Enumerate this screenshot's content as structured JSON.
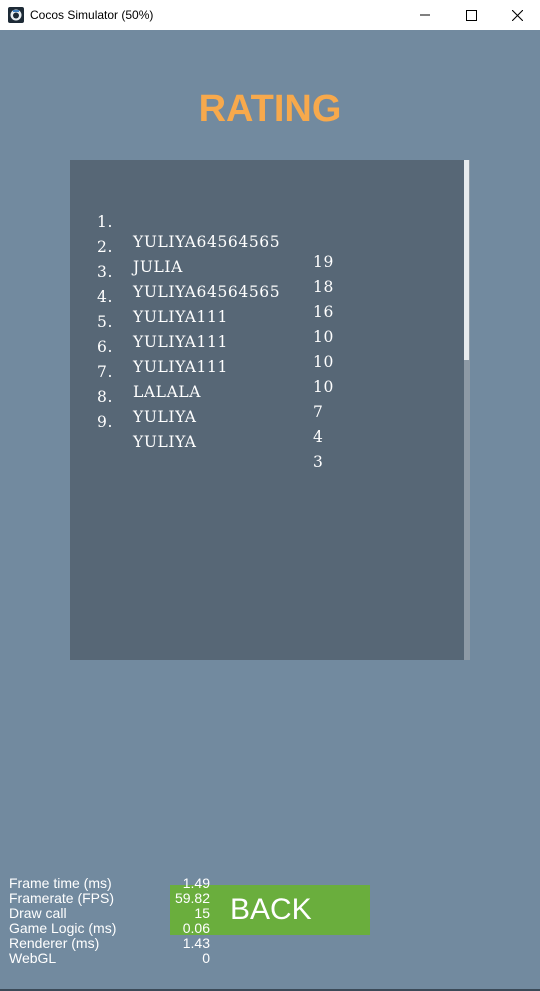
{
  "window": {
    "title": "Cocos Simulator (50%)",
    "app_icon": "cocos-app-icon",
    "controls": {
      "minimize": "minimize-icon",
      "maximize": "maximize-icon",
      "close": "close-icon"
    }
  },
  "screen": {
    "heading": "RATING",
    "back_label": "BACK"
  },
  "rating": [
    {
      "rank": "1.",
      "name": "YULIYA64564565",
      "score": "19"
    },
    {
      "rank": "2.",
      "name": "JULIA",
      "score": "18"
    },
    {
      "rank": "3.",
      "name": "YULIYA64564565",
      "score": "16"
    },
    {
      "rank": "4.",
      "name": "YULIYA111",
      "score": "10"
    },
    {
      "rank": "5.",
      "name": "YULIYA111",
      "score": "10"
    },
    {
      "rank": "6.",
      "name": "YULIYA111",
      "score": "10"
    },
    {
      "rank": "7.",
      "name": "LALALA",
      "score": "7"
    },
    {
      "rank": "8.",
      "name": "YULIYA",
      "score": "4"
    },
    {
      "rank": "9.",
      "name": "YULIYA",
      "score": "3"
    }
  ],
  "stats": [
    {
      "label": "Frame time (ms)",
      "value": "1.49"
    },
    {
      "label": "Framerate (FPS)",
      "value": "59.82"
    },
    {
      "label": "Draw call",
      "value": "15"
    },
    {
      "label": "Game Logic (ms)",
      "value": "0.06"
    },
    {
      "label": "Renderer (ms)",
      "value": "1.43"
    },
    {
      "label": "WebGL",
      "value": "0"
    }
  ],
  "colors": {
    "background": "#728a9f",
    "heading": "#f7a94c",
    "panel": "#576776",
    "button": "#6aae3d",
    "scroll_thumb": "#e7ebee"
  }
}
